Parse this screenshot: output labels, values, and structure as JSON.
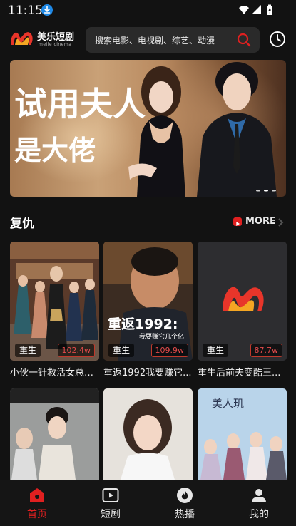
{
  "status_bar": {
    "time": "11:15",
    "icons": [
      "download-icon",
      "wifi-icon",
      "signal-icon",
      "battery-icon"
    ]
  },
  "header": {
    "logo_name": "美乐短剧",
    "logo_sub": "meile cinema",
    "search_placeholder": "搜索电影、电视剧、综艺、动漫",
    "search_icon": "search-icon",
    "history_icon": "clock-icon"
  },
  "banner": {
    "title_line1": "试用夫人",
    "title_line2": "是大佬",
    "active_index": 1,
    "page_count": 3
  },
  "section": {
    "title": "复仇",
    "more_label": "MORE"
  },
  "cards": [
    {
      "title": "小伙一针救活女总裁...",
      "tag": "重生",
      "count": "102.4w"
    },
    {
      "title": "重返1992我要赚它...",
      "tag": "重生",
      "count": "109.9w",
      "overlay_big": "重返1992:",
      "overlay_small": "我要赚它几个亿"
    },
    {
      "title": "重生后前夫变酷王...",
      "tag": "重生",
      "count": "87.7w"
    },
    {
      "title": "",
      "tag": "",
      "count": ""
    },
    {
      "title": "",
      "tag": "",
      "count": ""
    },
    {
      "title": "",
      "tag": "",
      "count": "",
      "overlay_big": "美人玑"
    }
  ],
  "bottom_nav": [
    {
      "label": "首页",
      "icon": "home-icon",
      "active": true
    },
    {
      "label": "短剧",
      "icon": "play-icon",
      "active": false
    },
    {
      "label": "热播",
      "icon": "flame-icon",
      "active": false
    },
    {
      "label": "我的",
      "icon": "user-icon",
      "active": false
    }
  ],
  "colors": {
    "background": "#121212",
    "accent": "#e02020",
    "search_bg": "#2a2a2a",
    "nav_bg": "#151515"
  }
}
